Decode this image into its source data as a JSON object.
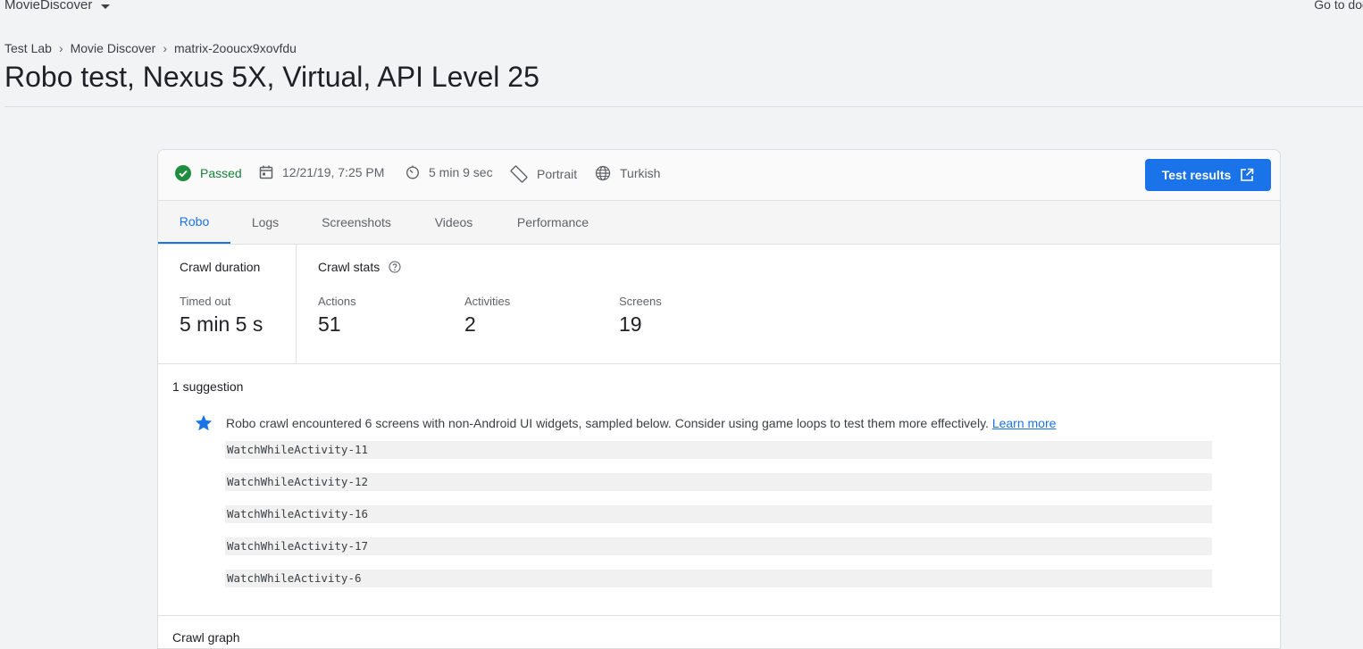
{
  "topbar": {
    "project": "MovieDiscover",
    "go_docs": "Go to doc"
  },
  "breadcrumb": [
    "Test Lab",
    "Movie Discover",
    "matrix-2oouсx9xovfdu"
  ],
  "page_title": "Robo test, Nexus 5X, Virtual, API Level 25",
  "summary": {
    "status": "Passed",
    "datetime": "12/21/19, 7:25 PM",
    "duration": "5 min 9 sec",
    "orientation": "Portrait",
    "locale": "Turkish",
    "test_results_label": "Test results"
  },
  "tabs": [
    {
      "label": "Robo"
    },
    {
      "label": "Logs"
    },
    {
      "label": "Screenshots"
    },
    {
      "label": "Videos"
    },
    {
      "label": "Performance"
    }
  ],
  "crawl_duration": {
    "title": "Crawl duration",
    "label": "Timed out",
    "value": "5 min 5 s"
  },
  "crawl_stats": {
    "title": "Crawl stats",
    "actions_label": "Actions",
    "actions_value": "51",
    "activities_label": "Activities",
    "activities_value": "2",
    "screens_label": "Screens",
    "screens_value": "19"
  },
  "suggestions": {
    "title": "1 suggestion",
    "text": "Robo crawl encountered 6 screens with non-Android UI widgets, sampled below. Consider using game loops to test them more effectively.",
    "link": "Learn more",
    "items": [
      "WatchWhileActivity-11",
      "WatchWhileActivity-12",
      "WatchWhileActivity-16",
      "WatchWhileActivity-17",
      "WatchWhileActivity-6"
    ]
  },
  "crawl_graph_title": "Crawl graph",
  "colors": {
    "accent": "#1a73e8",
    "passed": "#1e8e3e",
    "background": "#f1f3f4"
  }
}
